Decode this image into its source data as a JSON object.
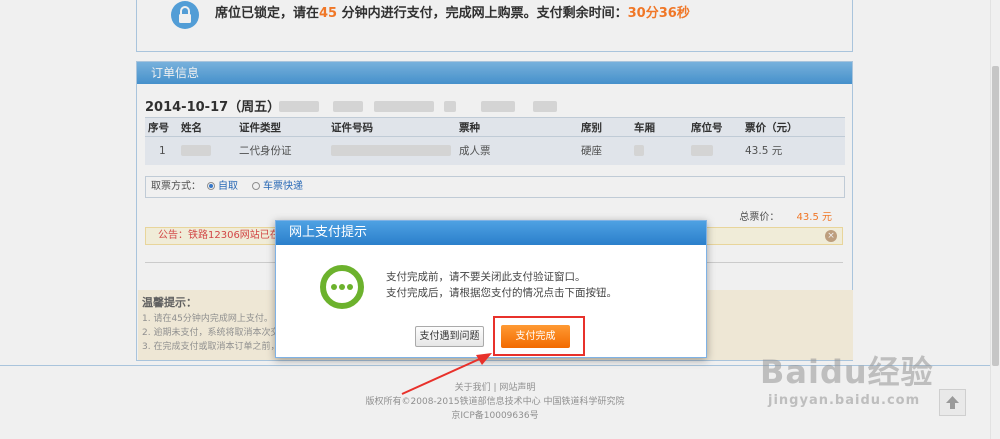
{
  "lock_notice": {
    "text_a": "席位已锁定，请在",
    "minutes": "45",
    "text_b": " 分钟内进行支付，完成网上购票。支付剩余时间：",
    "remaining": "30分36秒"
  },
  "order": {
    "header": "订单信息",
    "date": "2014-10-17（周五）",
    "columns": [
      "序号",
      "姓名",
      "证件类型",
      "证件号码",
      "票种",
      "席别",
      "车厢",
      "席位号",
      "票价（元）"
    ],
    "rows": [
      {
        "no": "1",
        "id_type": "二代身份证",
        "ticket_type": "成人票",
        "seat_class": "硬座",
        "price": "43.5 元"
      }
    ],
    "pickup_label": "取票方式：",
    "pickup_self": "自取",
    "pickup_express": "车票快递",
    "total_label": "总票价：",
    "total_value": "43.5 元",
    "notice": "公告：铁路12306网站已在北"
  },
  "tips": {
    "title": "温馨提示：",
    "items": [
      "1. 请在45分钟内完成网上支付。",
      "2. 逾期未支付，系统将取消本次交",
      "3. 在完成支付或取消本订单之前，"
    ]
  },
  "footer": {
    "links": "关于我们 | 网站声明",
    "copyright": "版权所有©2008-2015铁道部信息技术中心  中国铁道科学研究院",
    "icp": "京ICP备10009636号"
  },
  "modal": {
    "title": "网上支付提示",
    "line1": "支付完成前，请不要关闭此支付验证窗口。",
    "line2": "支付完成后，请根据您支付的情况点击下面按钮。",
    "btn_problem": "支付遇到问题",
    "btn_done": "支付完成",
    "icon": "more-dots-icon"
  },
  "watermark": {
    "main": "Baidu经验",
    "sub": "jingyan.baidu.com"
  },
  "colors": {
    "accent": "#4a9ad8",
    "orange": "#ff7f2a",
    "green": "#6cb22d",
    "highlight": "#e8312b"
  }
}
